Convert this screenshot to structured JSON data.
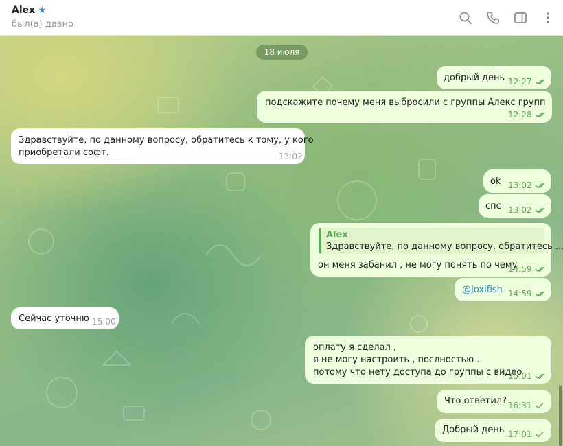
{
  "header": {
    "title": "Alex",
    "status": "был(а) давно",
    "icons": [
      "search-icon",
      "phone-icon",
      "sidebar-icon",
      "more-icon"
    ]
  },
  "chat": {
    "date": "18 июля",
    "messages": [
      {
        "dir": "out",
        "text": "добрый день",
        "time": "12:27",
        "status": "read"
      },
      {
        "dir": "out",
        "text": "подскажите почему меня выбросили с группы Алекс групп",
        "time": "12:28",
        "status": "read"
      },
      {
        "dir": "in",
        "text": "Здравствуйте, по данному вопросу, обратитесь к тому, у кого",
        "text2": "приобретали софт.",
        "time": "13:02"
      },
      {
        "dir": "out",
        "text": "ok",
        "time": "13:02",
        "status": "read"
      },
      {
        "dir": "out",
        "text": "спс",
        "time": "13:02",
        "status": "read"
      },
      {
        "dir": "out",
        "reply_name": "Alex",
        "reply_text": "Здравствуйте, по данному вопросу, обратитесь ...",
        "text": "он меня забанил , не могу понять по чему",
        "time": "14:59",
        "status": "read"
      },
      {
        "dir": "out",
        "text": "@Joxifish",
        "time": "14:59",
        "status": "read"
      },
      {
        "dir": "in",
        "text": "Сейчас уточню",
        "time": "15:00"
      },
      {
        "dir": "out",
        "text": "оплату я сделал ,",
        "text2": "я не могу настроить , послностью .",
        "text3": "потому что нету доступа до группы с видео",
        "time": "15:01",
        "status": "read"
      },
      {
        "dir": "out",
        "text": "Что ответил?",
        "time": "16:31",
        "status": "sent"
      },
      {
        "dir": "out",
        "text": "Добрый день",
        "time": "17:01",
        "status": "sent"
      }
    ]
  },
  "colors": {
    "outgoing_bubble": "#eeffde",
    "incoming_bubble": "#ffffff",
    "accent_green": "#5fab58",
    "link_blue": "#2a87c8",
    "star_blue": "#3a8fd6"
  }
}
